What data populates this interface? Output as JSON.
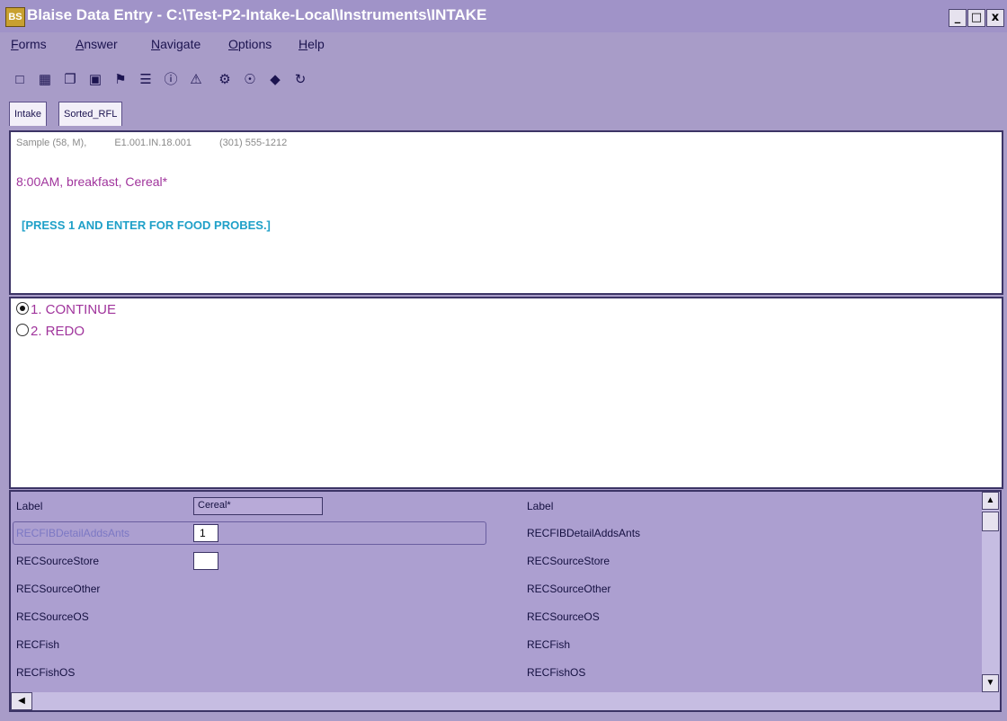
{
  "window": {
    "icon_text": "BS",
    "title": "Blaise Data Entry - C:\\Test-P2-Intake-Local\\Instruments\\INTAKE",
    "controls": [
      "_",
      "□",
      "x"
    ]
  },
  "menu": [
    {
      "first": "F",
      "rest": "orms"
    },
    {
      "first": "A",
      "rest": "nswer"
    },
    {
      "first": "N",
      "rest": "avigate"
    },
    {
      "first": "O",
      "rest": "ptions"
    },
    {
      "first": "H",
      "rest": "elp"
    }
  ],
  "toolbar": [
    "new-form-icon",
    "open-form-icon",
    "copy-form-icon",
    "save-icon",
    "find-icon",
    "lookup-icon",
    "question-help-icon",
    "error-icon",
    "remark-icon",
    "info-icon",
    "tag-icon",
    "refresh-icon"
  ],
  "tabs": [
    "Intake",
    "Sorted_RFL"
  ],
  "question": {
    "meta": [
      "Sample (58, M),",
      "E1.001.IN.18.001",
      "(301) 555-1212"
    ],
    "food_line": "8:00AM, breakfast, Cereal*",
    "instruction": "[PRESS 1 AND ENTER FOR FOOD PROBES.]"
  },
  "answers": [
    {
      "label": "1.  CONTINUE",
      "selected": true
    },
    {
      "label": "2.  REDO",
      "selected": false
    }
  ],
  "grid": {
    "header": {
      "left": "Label",
      "field": "Cereal*",
      "right": "Label"
    },
    "rows": [
      {
        "left": "RECFIBDetailAddsAnts",
        "value": "1",
        "right": "RECFIBDetailAddsAnts",
        "current": true,
        "has_box": true
      },
      {
        "left": "RECSourceStore",
        "value": "",
        "right": "RECSourceStore",
        "current": false,
        "has_box": true
      },
      {
        "left": "RECSourceOther",
        "value": "",
        "right": "RECSourceOther",
        "current": false,
        "has_box": false
      },
      {
        "left": "RECSourceOS",
        "value": "",
        "right": "RECSourceOS",
        "current": false,
        "has_box": false
      },
      {
        "left": "RECFish",
        "value": "",
        "right": "RECFish",
        "current": false,
        "has_box": false
      },
      {
        "left": "RECFishOS",
        "value": "",
        "right": "RECFishOS",
        "current": false,
        "has_box": false
      }
    ]
  },
  "colors": {
    "titlebar": "#a093c8",
    "food_text": "#a0349c",
    "instruction_text": "#1fa0c8"
  }
}
